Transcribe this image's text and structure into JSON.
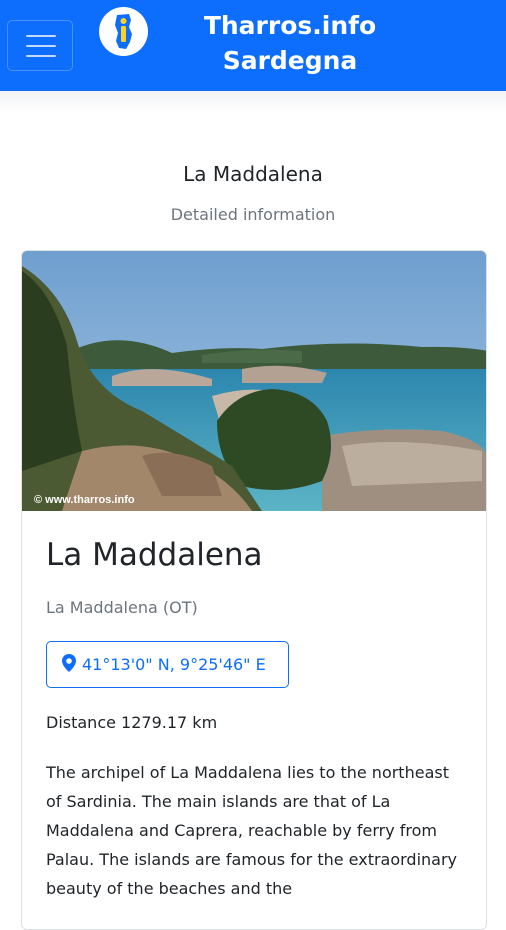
{
  "navbar": {
    "brand_line1": "Tharros.info",
    "brand_line2": "Sardegna",
    "menu_icon": "hamburger-icon",
    "logo_icon": "sardinia-info-logo",
    "color": "#0d6efd"
  },
  "header": {
    "title": "La Maddalena",
    "subtitle": "Detailed information"
  },
  "card": {
    "image_watermark": "© www.tharros.info",
    "title": "La Maddalena",
    "location": "La Maddalena (OT)",
    "coordinates": "41°13'0\" N, 9°25'46\" E",
    "coordinates_icon": "map-pin-icon",
    "distance": "Distance 1279.17 km",
    "description": "The archipel of La Maddalena lies to the northeast of Sardinia. The main islands are that of La Maddalena and Caprera, reachable by ferry from Palau. The islands are famous for the extraordinary beauty of the beaches and the"
  }
}
